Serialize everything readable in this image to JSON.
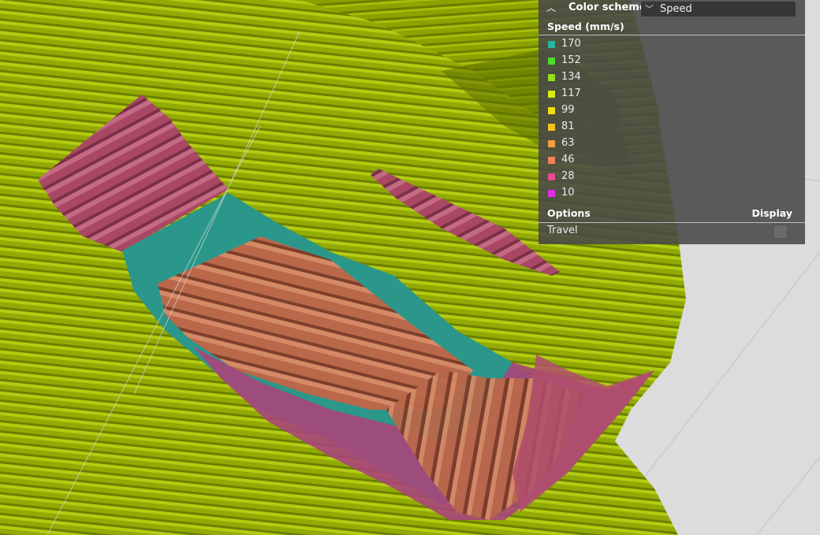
{
  "panel": {
    "header_label": "Color scheme",
    "color_scheme_value": "Speed",
    "legend_title": "Speed (mm/s)",
    "legend": [
      {
        "label": "170",
        "color": "#2ab3a0"
      },
      {
        "label": "152",
        "color": "#4fdc2a"
      },
      {
        "label": "134",
        "color": "#90e01c"
      },
      {
        "label": "117",
        "color": "#d8ec10"
      },
      {
        "label": "99",
        "color": "#f2de10"
      },
      {
        "label": "81",
        "color": "#f4c020"
      },
      {
        "label": "63",
        "color": "#f3a040"
      },
      {
        "label": "46",
        "color": "#ef8258"
      },
      {
        "label": "28",
        "color": "#ea4a8e"
      },
      {
        "label": "10",
        "color": "#e02ee0"
      }
    ],
    "options_title": "Options",
    "display_title": "Display",
    "travel_label": "Travel"
  },
  "colors": {
    "background": "#dcdcdc",
    "surface": "#8ea600",
    "line_light": "#a9c40a",
    "line_dark": "#6b7d00",
    "pink": "#b0506a",
    "magenta": "#b03d82",
    "orange": "#c46f4a",
    "teal": "#2f9b8e"
  }
}
